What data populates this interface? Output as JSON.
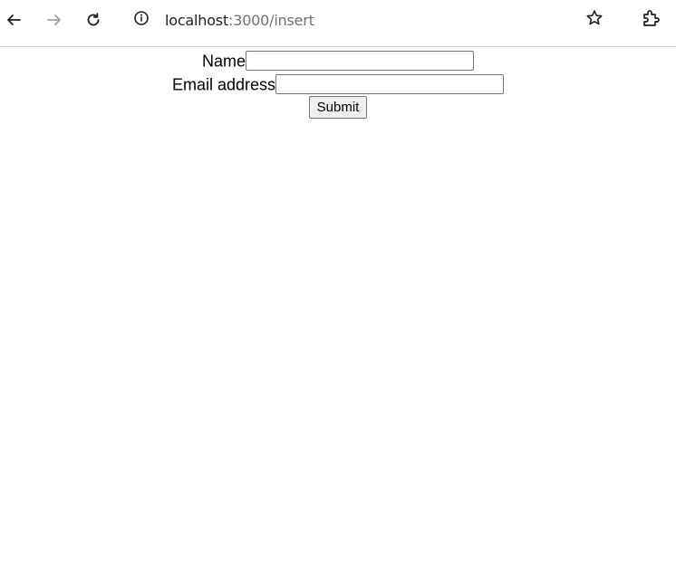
{
  "browser": {
    "url_host": "localhost",
    "url_path": ":3000/insert",
    "icons": [
      "back-arrow-icon",
      "forward-arrow-icon",
      "reload-icon",
      "site-info-icon",
      "bookmark-star-icon",
      "extensions-icon"
    ]
  },
  "form": {
    "name_label": "Name",
    "name_value": "",
    "email_label": "Email address",
    "email_value": "",
    "submit_label": "Submit"
  },
  "colors": {
    "toolbar_bg": "#ffffff",
    "icon_color": "#1f1f1f",
    "disabled_icon": "#9aa0a6",
    "url_path_color": "#707070"
  }
}
